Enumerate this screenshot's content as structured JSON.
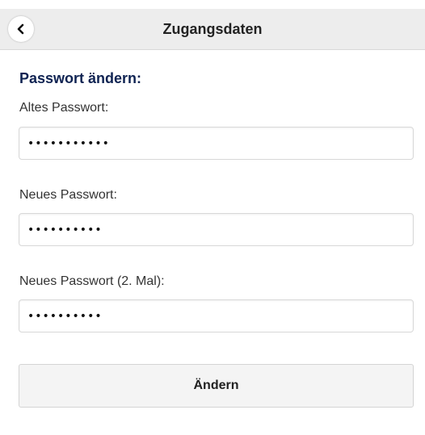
{
  "header": {
    "title": "Zugangsdaten",
    "back_icon": "chevron-left-icon"
  },
  "form": {
    "section_title": "Passwort ändern:",
    "old_password": {
      "label": "Altes Passwort:",
      "value": "•••••••••••"
    },
    "new_password": {
      "label": "Neues Passwort:",
      "value": "••••••••••"
    },
    "confirm_password": {
      "label": "Neues Passwort (2. Mal):",
      "value": "••••••••••"
    },
    "submit_label": "Ändern"
  },
  "colors": {
    "header_bg": "#ededed",
    "section_title": "#0f2352",
    "button_bg": "#f4f4f4"
  }
}
